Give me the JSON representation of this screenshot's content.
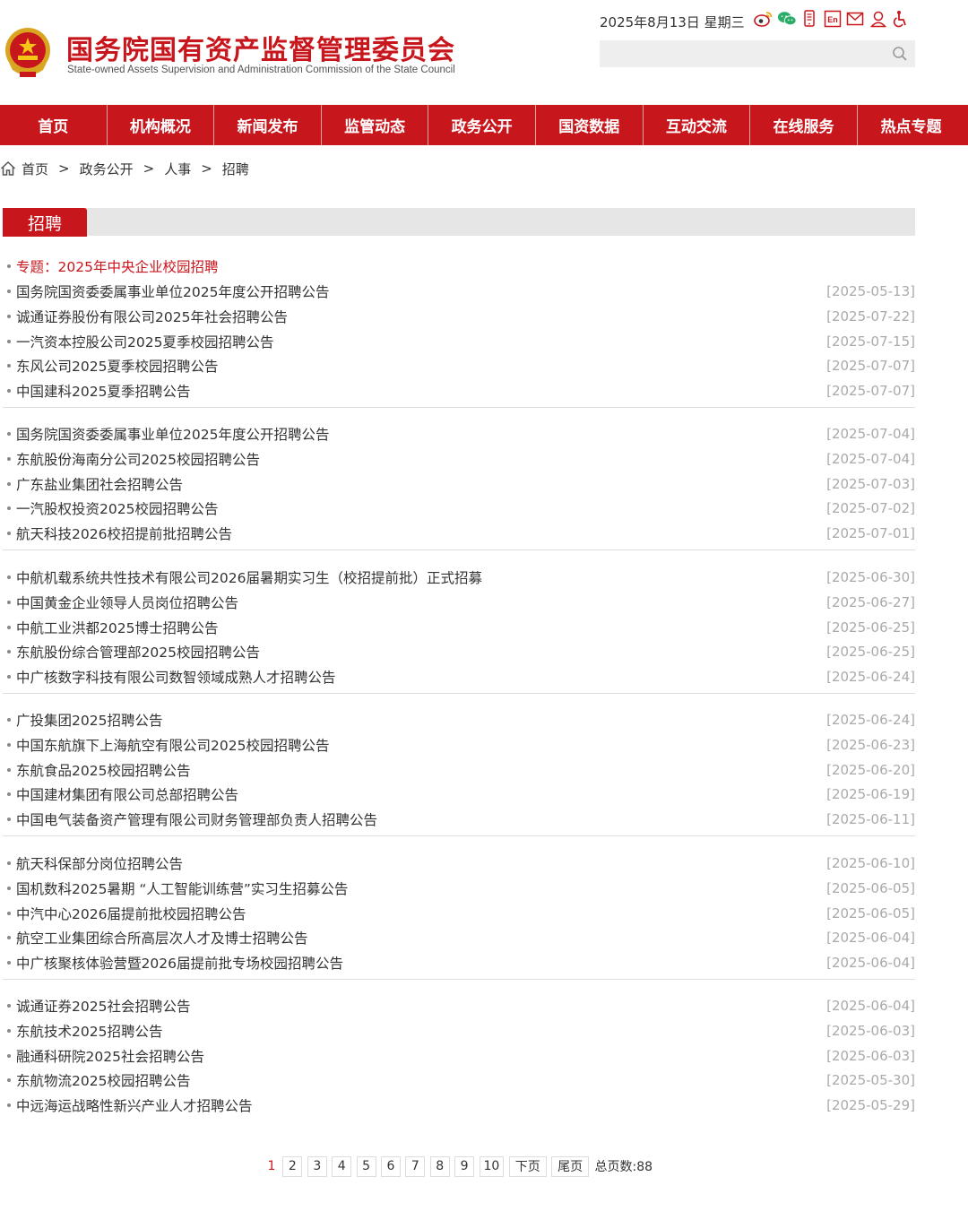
{
  "header": {
    "title": "国务院国有资产监督管理委员会",
    "subtitle": "State-owned Assets Supervision and Administration Commission of the State Council",
    "date": "2025年8月13日 星期三",
    "search_placeholder": "",
    "icons": [
      "weibo-icon",
      "wechat-icon",
      "mobile-icon",
      "english-icon",
      "mail-icon",
      "user-icon",
      "accessibility-icon"
    ]
  },
  "nav": {
    "items": [
      "首页",
      "机构概况",
      "新闻发布",
      "监管动态",
      "政务公开",
      "国资数据",
      "互动交流",
      "在线服务",
      "热点专题"
    ]
  },
  "breadcrumb": {
    "items": [
      "首页",
      "政务公开",
      "人事",
      "招聘"
    ],
    "separator": ">"
  },
  "section": {
    "title": "招聘"
  },
  "list": {
    "featured": "专题：2025年中央企业校园招聘",
    "groups": [
      [
        {
          "title": "国务院国资委委属事业单位2025年度公开招聘公告",
          "date": "[2025-05-13]"
        },
        {
          "title": "诚通证券股份有限公司2025年社会招聘公告",
          "date": "[2025-07-22]"
        },
        {
          "title": "一汽资本控股公司2025夏季校园招聘公告",
          "date": "[2025-07-15]"
        },
        {
          "title": "东风公司2025夏季校园招聘公告",
          "date": "[2025-07-07]"
        },
        {
          "title": "中国建科2025夏季招聘公告",
          "date": "[2025-07-07]"
        }
      ],
      [
        {
          "title": "国务院国资委委属事业单位2025年度公开招聘公告",
          "date": "[2025-07-04]"
        },
        {
          "title": "东航股份海南分公司2025校园招聘公告",
          "date": "[2025-07-04]"
        },
        {
          "title": "广东盐业集团社会招聘公告",
          "date": "[2025-07-03]"
        },
        {
          "title": "一汽股权投资2025校园招聘公告",
          "date": "[2025-07-02]"
        },
        {
          "title": "航天科技2026校招提前批招聘公告",
          "date": "[2025-07-01]"
        }
      ],
      [
        {
          "title": "中航机载系统共性技术有限公司2026届暑期实习生（校招提前批）正式招募",
          "date": "[2025-06-30]"
        },
        {
          "title": "中国黄金企业领导人员岗位招聘公告",
          "date": "[2025-06-27]"
        },
        {
          "title": "中航工业洪都2025博士招聘公告",
          "date": "[2025-06-25]"
        },
        {
          "title": "东航股份综合管理部2025校园招聘公告",
          "date": "[2025-06-25]"
        },
        {
          "title": "中广核数字科技有限公司数智领域成熟人才招聘公告",
          "date": "[2025-06-24]"
        }
      ],
      [
        {
          "title": "广投集团2025招聘公告",
          "date": "[2025-06-24]"
        },
        {
          "title": "中国东航旗下上海航空有限公司2025校园招聘公告",
          "date": "[2025-06-23]"
        },
        {
          "title": "东航食品2025校园招聘公告",
          "date": "[2025-06-20]"
        },
        {
          "title": "中国建材集团有限公司总部招聘公告",
          "date": "[2025-06-19]"
        },
        {
          "title": "中国电气装备资产管理有限公司财务管理部负责人招聘公告",
          "date": "[2025-06-11]"
        }
      ],
      [
        {
          "title": "航天科保部分岗位招聘公告",
          "date": "[2025-06-10]"
        },
        {
          "title": "国机数科2025暑期 “人工智能训练营”实习生招募公告",
          "date": "[2025-06-05]"
        },
        {
          "title": "中汽中心2026届提前批校园招聘公告",
          "date": "[2025-06-05]"
        },
        {
          "title": "航空工业集团综合所高层次人才及博士招聘公告",
          "date": "[2025-06-04]"
        },
        {
          "title": "中广核聚核体验营暨2026届提前批专场校园招聘公告",
          "date": "[2025-06-04]"
        }
      ],
      [
        {
          "title": "诚通证券2025社会招聘公告",
          "date": "[2025-06-04]"
        },
        {
          "title": "东航技术2025招聘公告",
          "date": "[2025-06-03]"
        },
        {
          "title": "融通科研院2025社会招聘公告",
          "date": "[2025-06-03]"
        },
        {
          "title": "东航物流2025校园招聘公告",
          "date": "[2025-05-30]"
        },
        {
          "title": "中远海运战略性新兴产业人才招聘公告",
          "date": "[2025-05-29]"
        }
      ]
    ]
  },
  "pagination": {
    "current": "1",
    "pages": [
      "2",
      "3",
      "4",
      "5",
      "6",
      "7",
      "8",
      "9",
      "10"
    ],
    "next_label": "下页",
    "last_label": "尾页",
    "total_label": "总页数:88"
  },
  "colors": {
    "brand_red": "#c8161d",
    "date_gray": "#aaaaaa",
    "section_bar": "#e6e6e6"
  }
}
